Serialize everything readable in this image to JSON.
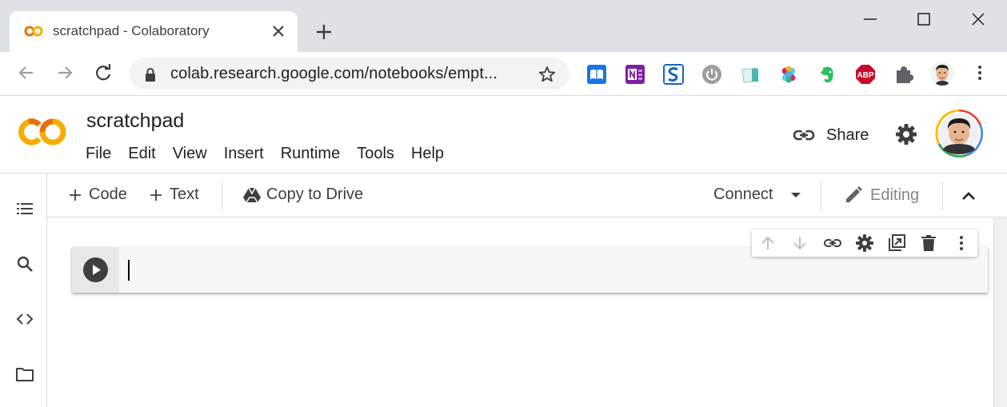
{
  "browser": {
    "tab": {
      "title": "scratchpad - Colaboratory"
    },
    "omnibox": {
      "url": "colab.research.google.com/notebooks/empt..."
    },
    "extensions": [
      {
        "name": "reader-icon",
        "color": "#1a73e8"
      },
      {
        "name": "onenote-icon",
        "color": "#7b1fa2"
      },
      {
        "name": "s-icon",
        "color": "#1565c0"
      },
      {
        "name": "power-icon",
        "color": "#9e9e9e"
      },
      {
        "name": "note-icon",
        "color": "#4db6ac"
      },
      {
        "name": "slack-icon",
        "color": "#e01e5a"
      },
      {
        "name": "evernote-icon",
        "color": "#2dbe60"
      },
      {
        "name": "abp-icon",
        "color": "#c70d2c"
      },
      {
        "name": "puzzle-icon",
        "color": "#5f6368"
      }
    ],
    "abp_text": "ABP"
  },
  "colab": {
    "notebook_title": "scratchpad",
    "menu": [
      "File",
      "Edit",
      "View",
      "Insert",
      "Runtime",
      "Tools",
      "Help"
    ],
    "share_label": "Share"
  },
  "toolbar": {
    "code_label": "Code",
    "text_label": "Text",
    "copy_label": "Copy to Drive",
    "connect_label": "Connect",
    "editing_label": "Editing"
  },
  "colors": {
    "accent_orange": "#f9ab00",
    "accent_dark_orange": "#e8710a",
    "chrome_bg": "#dee1e6"
  }
}
